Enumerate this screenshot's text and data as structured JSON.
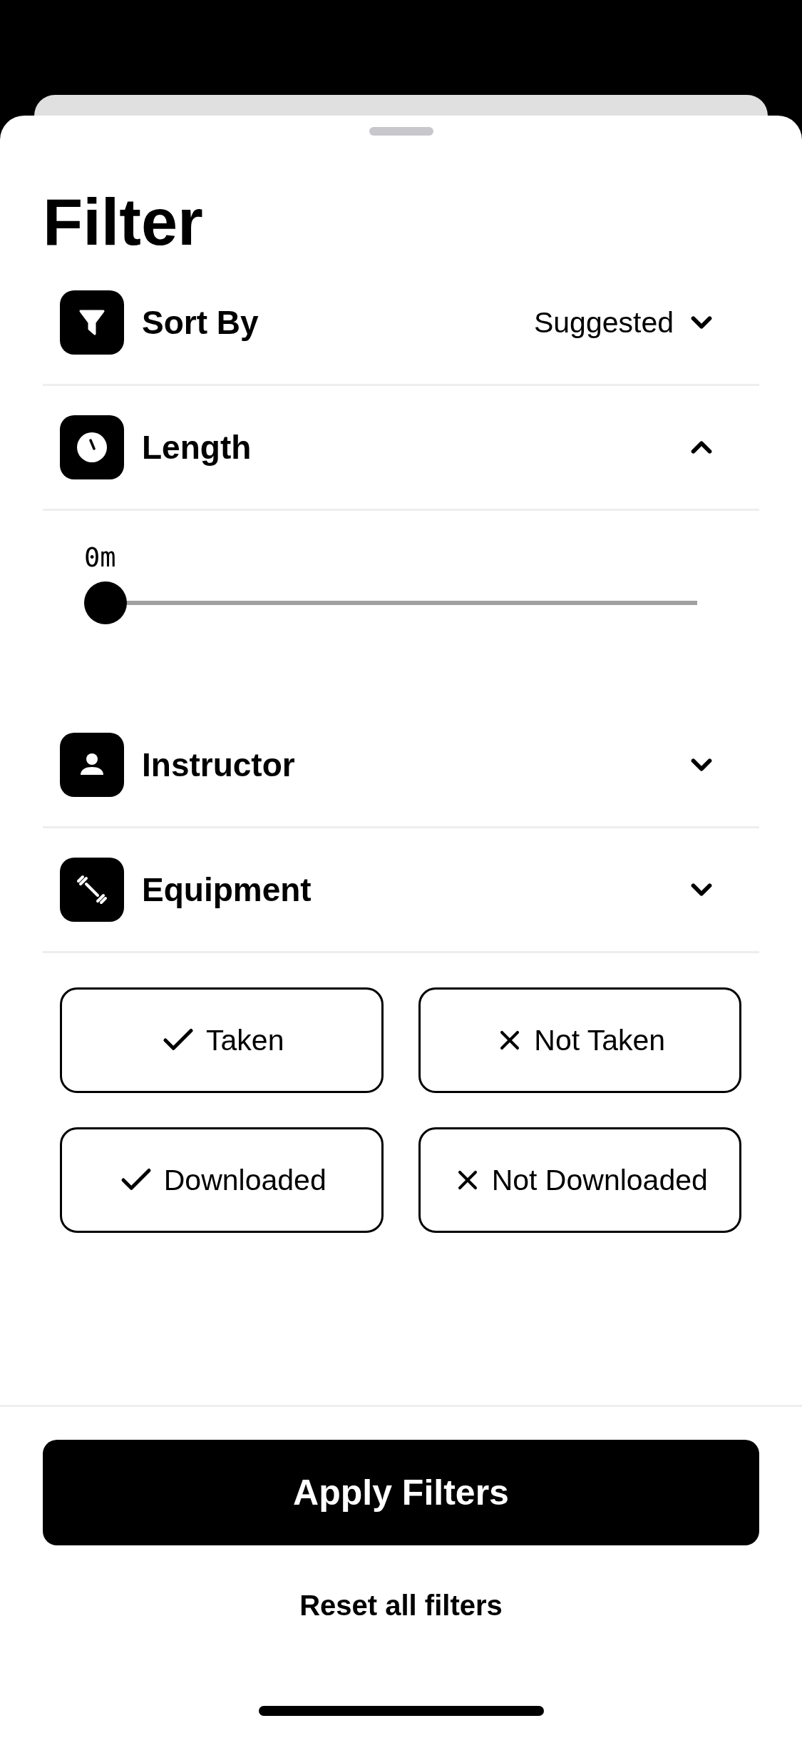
{
  "title": "Filter",
  "sections": [
    {
      "label": "Sort By",
      "kind": "select",
      "value": "Suggested",
      "expanded": false
    },
    {
      "label": "Length",
      "kind": "range",
      "expanded": true,
      "reading": "0m",
      "level": 0
    },
    {
      "label": "Instructor",
      "kind": "list",
      "expanded": false
    },
    {
      "label": "Equipment",
      "kind": "list",
      "expanded": false
    }
  ],
  "chips": [
    {
      "label": "Taken",
      "kind": "include",
      "selected": false
    },
    {
      "label": "Not Taken",
      "kind": "exclude",
      "selected": false
    },
    {
      "label": "Downloaded",
      "kind": "include",
      "selected": false
    },
    {
      "label": "Not Downloaded",
      "kind": "exclude",
      "selected": false
    }
  ],
  "apply_button": "Apply Filters",
  "reset_link": "Reset all filters"
}
